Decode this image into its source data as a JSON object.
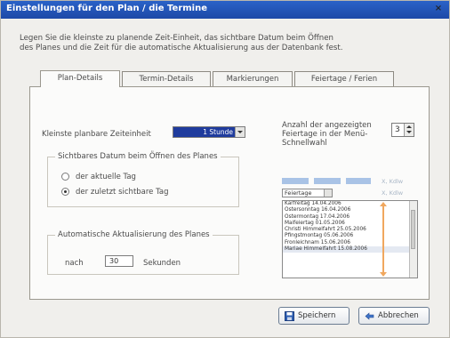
{
  "window": {
    "title": "Einstellungen für den Plan / die Termine",
    "close_label": "×"
  },
  "intro": {
    "line1": "Legen Sie die kleinste zu planende Zeit-Einheit, das sichtbare Datum beim Öffnen",
    "line2": "des Planes und die Zeit für die automatische Aktualisierung aus der Datenbank fest."
  },
  "tabs": [
    {
      "label": "Plan-Details",
      "active": true
    },
    {
      "label": "Termin-Details",
      "active": false
    },
    {
      "label": "Markierungen",
      "active": false
    },
    {
      "label": "Feiertage / Ferien",
      "active": false
    }
  ],
  "plan": {
    "smallest_unit_label": "Kleinste planbare Zeiteinheit",
    "smallest_unit_value": "1 Stunde",
    "visible_date": {
      "legend": "Sichtbares Datum beim Öffnen des Planes",
      "options": [
        {
          "label": "der aktuelle Tag",
          "checked": false
        },
        {
          "label": "der zuletzt sichtbare Tag",
          "checked": true
        }
      ]
    },
    "auto_refresh": {
      "legend": "Automatische Aktualisierung des Planes",
      "prefix": "nach",
      "value": "30",
      "suffix": "Sekunden"
    },
    "holiday_count": {
      "label_line1": "Anzahl der angezeigten",
      "label_line2": "Feiertage in der Menü-",
      "label_line3": "Schnellwahl",
      "value": "3"
    }
  },
  "preview": {
    "faint_right_top": "X, Kdlw",
    "faint_right_mid": "X, Kdlw",
    "combo_value": "Feiertage",
    "items": [
      "Karfreitag 14.04.2006",
      "Ostersonntag 16.04.2006",
      "Ostermontag 17.04.2006",
      "Maifeiertag 01.05.2006",
      "Christi Himmelfahrt 25.05.2006",
      "Pfingstmontag 05.06.2006",
      "Fronleichnam 15.06.2006",
      "Mariae Himmelfahrt 15.08.2006"
    ],
    "accent_color": "#f0a75e"
  },
  "buttons": {
    "save": "Speichern",
    "cancel": "Abbrechen"
  },
  "colors": {
    "titlebar": "#2a62c8",
    "selection": "#1f3b9d"
  }
}
